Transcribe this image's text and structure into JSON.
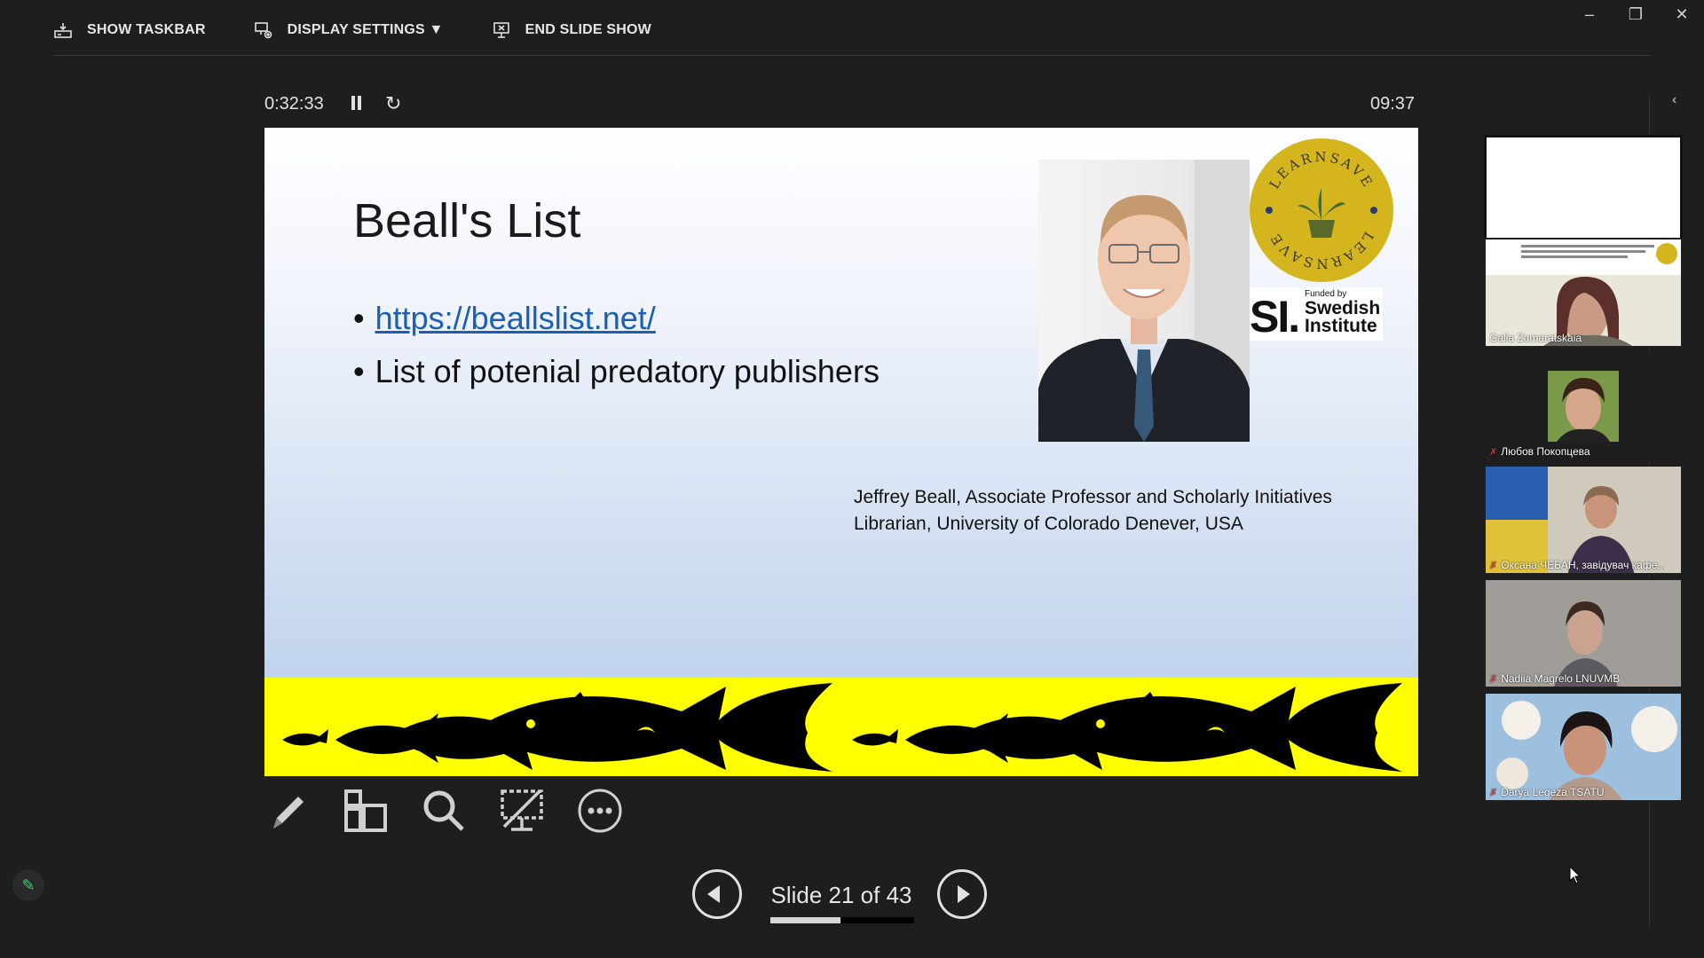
{
  "toolbar": {
    "show_taskbar": "SHOW TASKBAR",
    "display_settings": "DISPLAY SETTINGS ▼",
    "end_slide_show": "END SLIDE SHOW"
  },
  "timer": {
    "elapsed": "0:32:33",
    "clock": "09:37"
  },
  "slide": {
    "title": "Beall's List",
    "bullets": {
      "link": "https://beallslist.net/",
      "text": "List of potenial predatory publishers"
    },
    "caption_line1": "Jeffrey Beall, Associate Professor and Scholarly Initiatives",
    "caption_line2": "Librarian, University of Colorado Denever, USA",
    "logo_text": "LEARNSAVE",
    "si_mark": "SI.",
    "si_funded": "Funded by",
    "si_name_1": "Swedish",
    "si_name_2": "Institute"
  },
  "navigator": {
    "counter": "Slide 21 of 43",
    "progress_fraction": 0.4884
  },
  "participants": [
    {
      "name": "",
      "type": "blank"
    },
    {
      "name": "Galia Zamaratskaia",
      "muted": false
    },
    {
      "name": "Любов Покопцева",
      "muted": true
    },
    {
      "name": "Оксана ЧЕБАН, завідувач кафе...",
      "muted": true
    },
    {
      "name": "Nadiia Magrelo LNUVMB",
      "muted": true
    },
    {
      "name": "Darya Legeza TSATU",
      "muted": true
    }
  ],
  "colors": {
    "background": "#1e1e1e",
    "link": "#1a5fb4",
    "shark_band": "#ffff00",
    "logo_gold": "#d4b51e",
    "mute_red": "#e5383b"
  },
  "icons": {
    "show_taskbar": "taskbar-icon",
    "display_settings": "monitor-gear-icon",
    "end_slide_show": "end-show-icon",
    "pen": "pen-icon",
    "all_slides": "grid-icon",
    "zoom": "magnifier-icon",
    "black_screen": "black-screen-icon",
    "more": "more-icon"
  }
}
